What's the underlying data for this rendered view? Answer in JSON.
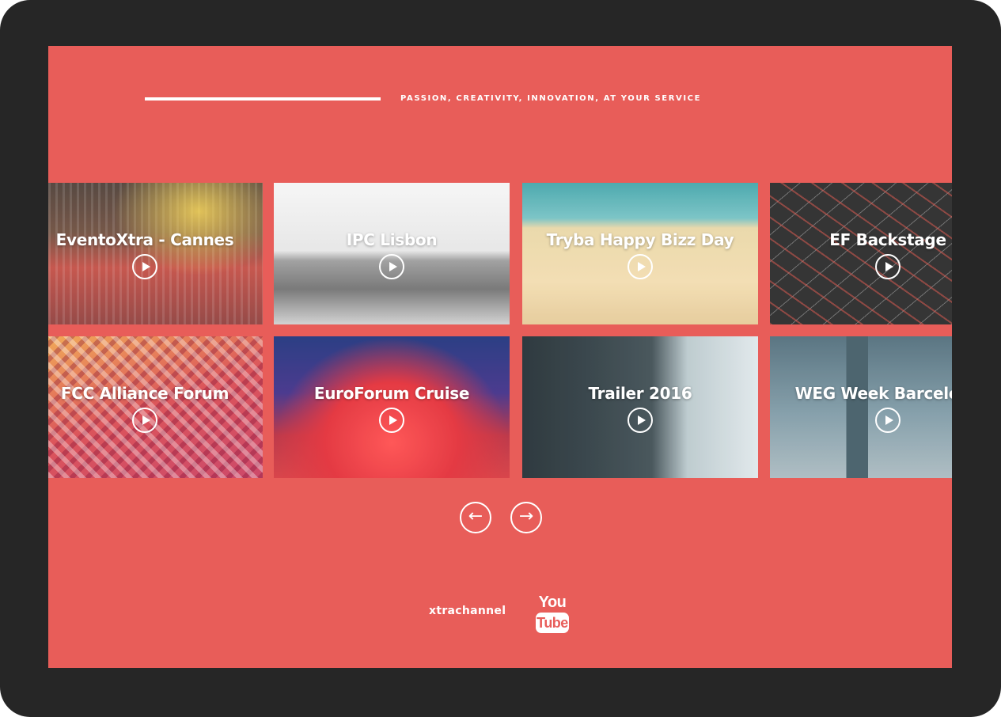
{
  "header": {
    "tagline": "PASSION, CREATIVITY, INNOVATION, AT YOUR SERVICE"
  },
  "videos": [
    {
      "title": "EventoXtra - Cannes"
    },
    {
      "title": "IPC Lisbon"
    },
    {
      "title": "Tryba Happy Bizz Day"
    },
    {
      "title": "EF Backstage"
    },
    {
      "title": "FCC Alliance Forum"
    },
    {
      "title": "EuroForum Cruise"
    },
    {
      "title": "Trailer 2016"
    },
    {
      "title": "WEG Week Barcelona"
    }
  ],
  "carousel": {
    "prev_icon": "←",
    "next_icon": "→"
  },
  "footer": {
    "channel": "xtrachannel",
    "youtube_you": "You",
    "youtube_tube": "Tube"
  },
  "colors": {
    "background": "#e85d59",
    "frame": "#262626",
    "text": "#ffffff"
  }
}
